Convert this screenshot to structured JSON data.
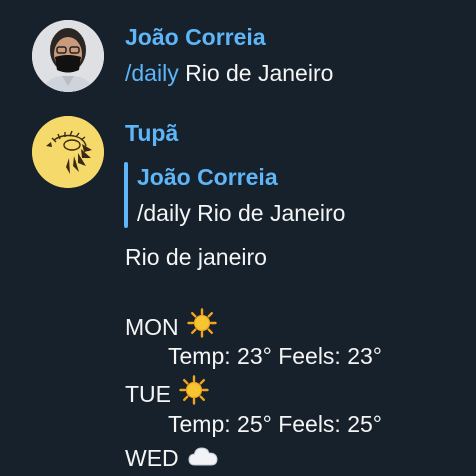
{
  "messages": [
    {
      "sender": "João Correia",
      "command": "/daily",
      "text": "Rio de Janeiro"
    },
    {
      "sender": "Tupã",
      "reply_to": {
        "sender": "João Correia",
        "text": "/daily Rio de Janeiro"
      },
      "location": "Rio de janeiro",
      "forecast": [
        {
          "day": "MON",
          "icon": "sun-icon",
          "detail": "Temp: 23° Feels: 23°"
        },
        {
          "day": "TUE",
          "icon": "sun-icon",
          "detail": "Temp: 25° Feels: 25°"
        },
        {
          "day": "WED",
          "icon": "cloud-icon"
        }
      ]
    }
  ],
  "colors": {
    "background": "#17212b",
    "accent": "#5eb5f7",
    "text": "#f5f5f5"
  }
}
